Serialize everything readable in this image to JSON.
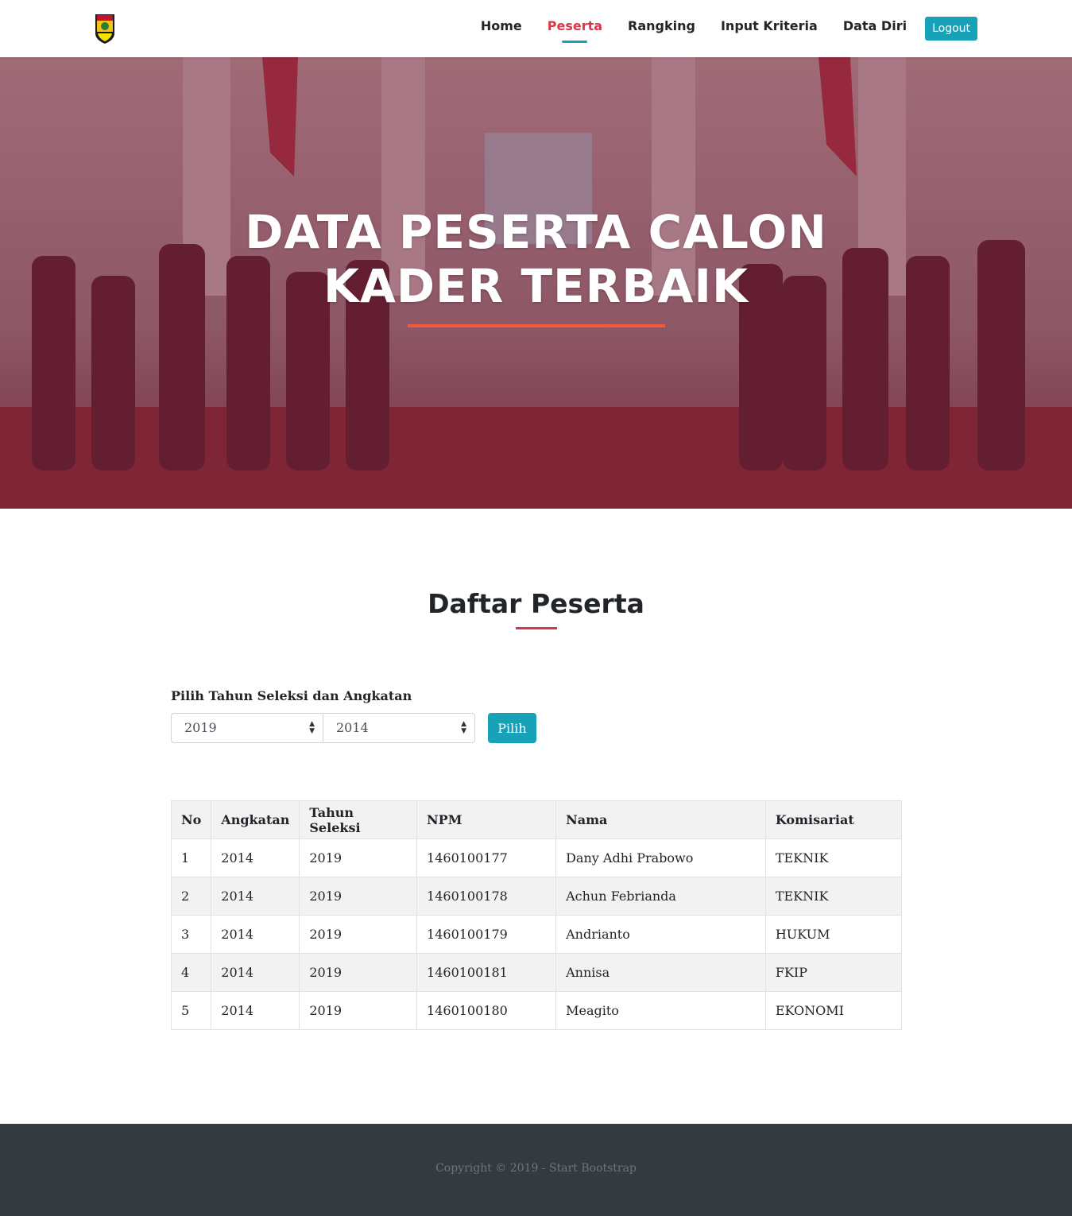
{
  "navbar": {
    "brand_logo": "organization-crest-logo",
    "links": [
      {
        "label": "Home",
        "active": false
      },
      {
        "label": "Peserta",
        "active": true
      },
      {
        "label": "Rangking",
        "active": false
      },
      {
        "label": "Input Kriteria",
        "active": false
      },
      {
        "label": "Data Diri",
        "active": false
      }
    ],
    "logout_label": "Logout"
  },
  "hero": {
    "title_line1": "DATA PESERTA CALON",
    "title_line2": "KADER TERBAIK",
    "accent_color": "#f05a36",
    "overlay_color": "#6e1e32"
  },
  "main": {
    "title": "Daftar Peserta",
    "filter": {
      "label": "Pilih Tahun Seleksi dan Angkatan",
      "tahun_value": "2019",
      "angkatan_value": "2014",
      "submit_label": "Pilih"
    },
    "table": {
      "headers": [
        "No",
        "Angkatan",
        "Tahun Seleksi",
        "NPM",
        "Nama",
        "Komisariat"
      ],
      "rows": [
        [
          "1",
          "2014",
          "2019",
          "1460100177",
          "Dany Adhi Prabowo",
          "TEKNIK"
        ],
        [
          "2",
          "2014",
          "2019",
          "1460100178",
          "Achun Febrianda",
          "TEKNIK"
        ],
        [
          "3",
          "2014",
          "2019",
          "1460100179",
          "Andrianto",
          "HUKUM"
        ],
        [
          "4",
          "2014",
          "2019",
          "1460100181",
          "Annisa",
          "FKIP"
        ],
        [
          "5",
          "2014",
          "2019",
          "1460100180",
          "Meagito",
          "EKONOMI"
        ]
      ]
    }
  },
  "footer": {
    "copyright": "Copyright © 2019 - Start Bootstrap"
  },
  "colors": {
    "primary_button": "#17a2b8",
    "active_link": "#dc3545",
    "footer_bg": "#343a40"
  }
}
